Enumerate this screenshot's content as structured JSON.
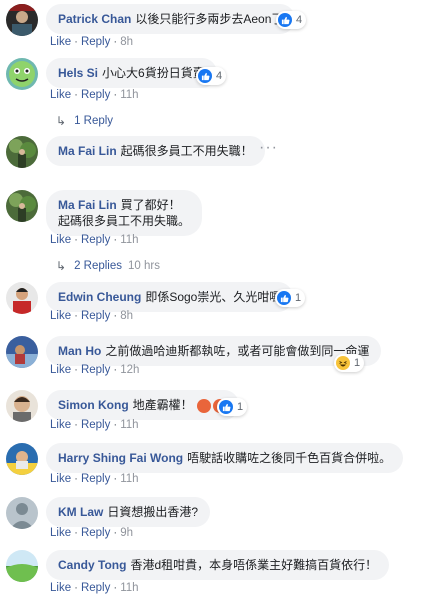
{
  "comments": [
    {
      "name": "Patrick Chan",
      "text": "以後只能行多兩步去Aeon了",
      "reaction_count": "4",
      "reaction_types": [
        "like"
      ],
      "time": "8h"
    },
    {
      "name": "Hels Si",
      "text": "小心大6貨扮日貨賣",
      "reaction_count": "4",
      "reaction_types": [
        "like"
      ],
      "time": "11h"
    },
    {
      "name": "Ma Fai Lin",
      "text": "起碼很多員工不用失職！",
      "time": ""
    },
    {
      "name": "Ma Fai Lin",
      "text": "買了都好！",
      "text2": "起碼很多員工不用失職。",
      "time": "11h"
    },
    {
      "name": "Edwin Cheung",
      "text": "即係Sogo崇光、久光咁囉",
      "reaction_count": "1",
      "reaction_types": [
        "like"
      ],
      "time": "8h"
    },
    {
      "name": "Man Ho",
      "text": "之前做過哈迪斯都執咗，或者可能會做到同一命運",
      "reaction_count": "1",
      "reaction_types": [
        "haha"
      ],
      "time": "12h"
    },
    {
      "name": "Simon Kong",
      "text": "地產霸權！",
      "emoji_count": 2,
      "reaction_count": "1",
      "reaction_types": [
        "like"
      ],
      "time": "11h"
    },
    {
      "name": "Harry Shing Fai Wong",
      "text": "唔駛話收購咗之後同千色百貨合併啦。",
      "time": "11h"
    },
    {
      "name": "KM Law",
      "text": "日資想搬出香港?",
      "time": "9h"
    },
    {
      "name": "Candy Tong",
      "text": "香港d租咁貴，本身唔係業主好難搞百貨依行！",
      "time": "11h"
    }
  ],
  "actions": {
    "like": "Like",
    "reply": "Reply",
    "separator": "·"
  },
  "reply_threads": [
    {
      "label": "1 Reply",
      "time": ""
    },
    {
      "label": "2 Replies",
      "time": "10 hrs"
    }
  ],
  "more_glyph": "···",
  "colors": {
    "link": "#385898",
    "bubble": "#f2f3f5",
    "like": "#1877f2",
    "meta": "#606770"
  },
  "icons": {
    "like": "thumbs-up-icon",
    "haha": "laughing-face-icon",
    "angry": "angry-face-icon",
    "reply_arrow": "reply-arrow-icon"
  }
}
